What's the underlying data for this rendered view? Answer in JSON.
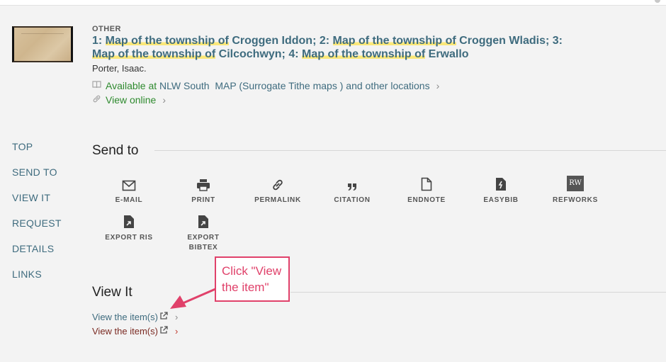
{
  "record": {
    "type": "OTHER",
    "title_parts": [
      {
        "text": "1: ",
        "hl": false
      },
      {
        "text": "Map of the township of",
        "hl": true
      },
      {
        "text": " Croggen Iddon; 2: ",
        "hl": false
      },
      {
        "text": "Map of the township of",
        "hl": true
      },
      {
        "text": " Croggen Wladis; 3: ",
        "hl": false
      },
      {
        "text": "Map of the township of",
        "hl": true
      },
      {
        "text": " Cilcochwyn; 4: ",
        "hl": false
      },
      {
        "text": "Map of the township of",
        "hl": true
      },
      {
        "text": " Erwallo",
        "hl": false
      }
    ],
    "author": "Porter, Isaac.",
    "availability": {
      "status": "Available at",
      "location": " NLW South  MAP (Surrogate Tithe maps ) and other locations"
    },
    "view_online": "View online"
  },
  "sidenav": [
    "TOP",
    "SEND TO",
    "VIEW IT",
    "REQUEST",
    "DETAILS",
    "LINKS"
  ],
  "send_to": {
    "title": "Send to",
    "actions": [
      {
        "label": "E-MAIL",
        "icon": "mail-icon"
      },
      {
        "label": "PRINT",
        "icon": "printer-icon"
      },
      {
        "label": "PERMALINK",
        "icon": "link-icon"
      },
      {
        "label": "CITATION",
        "icon": "quote-icon"
      },
      {
        "label": "ENDNOTE",
        "icon": "document-icon"
      },
      {
        "label": "EASYBIB",
        "icon": "easybib-icon"
      },
      {
        "label": "REFWORKS",
        "icon": "refworks-icon",
        "badge": "RW"
      },
      {
        "label": "EXPORT RIS",
        "icon": "export-file-icon"
      },
      {
        "label": "EXPORT\nBIBTEX",
        "icon": "export-file-icon"
      }
    ]
  },
  "view_it": {
    "title": "View It",
    "links": [
      "View the item(s)",
      "View the item(s)"
    ]
  },
  "callout": {
    "text": "Click \"View the item\""
  },
  "colors": {
    "link": "#3e6b7e",
    "available": "#2e8a2e",
    "highlight": "#fbe879",
    "callout": "#e0416a",
    "second_link": "#7a2a22"
  }
}
